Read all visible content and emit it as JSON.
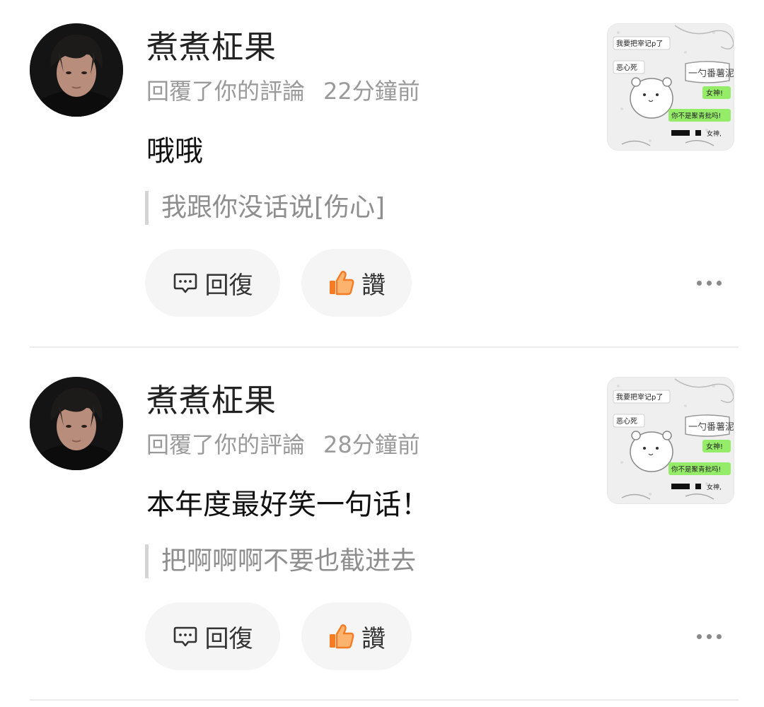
{
  "notifications": [
    {
      "username": "煮煮柾果",
      "action": "回覆了你的評論",
      "time": "22分鐘前",
      "content": "哦哦",
      "quoted": "我跟你没话说[伤心]",
      "reply_label": "回復",
      "like_label": "讚",
      "thumbnail": {
        "bubble_left_1": "我要把宰记p了",
        "bubble_left_2": "恶心死",
        "bubble_right_1": "女神!",
        "bubble_right_2": "你不是聚青批吗!",
        "scribble_text": "一勺番薯泥",
        "small_text": "女神,"
      }
    },
    {
      "username": "煮煮柾果",
      "action": "回覆了你的評論",
      "time": "28分鐘前",
      "content": "本年度最好笑一句话！",
      "quoted": "把啊啊啊不要也截进去",
      "reply_label": "回復",
      "like_label": "讚",
      "thumbnail": {
        "bubble_left_1": "我要把宰记p了",
        "bubble_left_2": "恶心死",
        "bubble_right_1": "女神!",
        "bubble_right_2": "你不是聚青批吗!",
        "scribble_text": "一勺番薯泥",
        "small_text": "女神,"
      }
    }
  ],
  "icons": {
    "reply": "comment-bubble-icon",
    "like": "thumbs-up-icon",
    "more": "more-dots-icon"
  },
  "colors": {
    "like_orange": "#f57c24",
    "bubble_green": "#95ec69",
    "secondary_text": "#9a9a9a",
    "button_bg": "#f5f5f5"
  }
}
